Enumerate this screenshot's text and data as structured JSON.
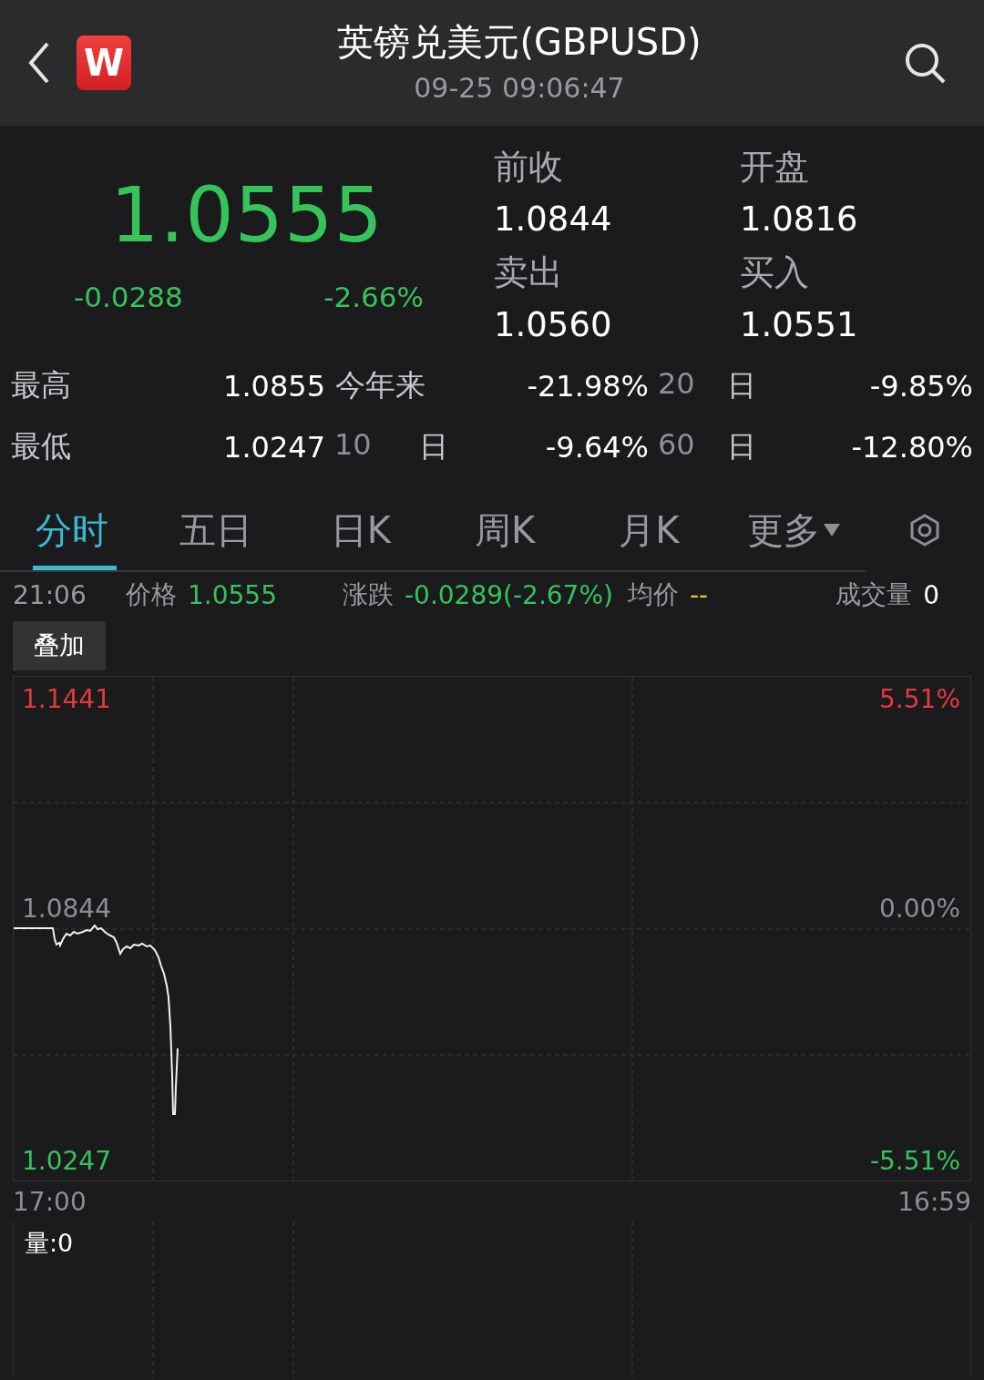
{
  "header": {
    "title": "英镑兑美元(GBPUSD)",
    "timestamp": "09-25 09:06:47",
    "logo_text": "W"
  },
  "quote": {
    "price": "1.0555",
    "change": "-0.0288",
    "change_percent": "-2.66%",
    "color": "#35c35a",
    "fields": [
      {
        "label": "前收",
        "value": "1.0844"
      },
      {
        "label": "开盘",
        "value": "1.0816"
      },
      {
        "label": "卖出",
        "value": "1.0560"
      },
      {
        "label": "买入",
        "value": "1.0551"
      }
    ]
  },
  "stats": [
    [
      {
        "kind": "label",
        "text": "最高"
      },
      {
        "kind": "value",
        "text": "1.0855"
      },
      {
        "kind": "label",
        "text": "今年来"
      },
      {
        "kind": "value",
        "text": "-21.98%"
      },
      {
        "kind": "period",
        "number": "20",
        "unit": "日"
      },
      {
        "kind": "value",
        "text": "-9.85%"
      }
    ],
    [
      {
        "kind": "label",
        "text": "最低"
      },
      {
        "kind": "value",
        "text": "1.0247"
      },
      {
        "kind": "period",
        "number": "10",
        "unit": "日"
      },
      {
        "kind": "value",
        "text": "-9.64%"
      },
      {
        "kind": "period",
        "number": "60",
        "unit": "日"
      },
      {
        "kind": "value",
        "text": "-12.80%"
      }
    ]
  ],
  "tabs": [
    {
      "label": "分时",
      "selected": true
    },
    {
      "label": "五日",
      "selected": false
    },
    {
      "label": "日K",
      "selected": false
    },
    {
      "label": "周K",
      "selected": false
    },
    {
      "label": "月K",
      "selected": false
    },
    {
      "label": "更多",
      "selected": false,
      "kind": "dropdown"
    }
  ],
  "info_bar": {
    "time": "21:06",
    "items": [
      {
        "label": "价格",
        "value": "1.0555",
        "color": "#35c35a"
      },
      {
        "label": "涨跌",
        "value": "-0.0289(-2.67%)",
        "color": "#35c35a"
      },
      {
        "label": "均价",
        "value": "--",
        "color": "#e8c234"
      },
      {
        "label": "成交量",
        "value": "0",
        "color": "#ffffff"
      }
    ]
  },
  "overlay_button": "叠加",
  "chart": {
    "y_left": [
      {
        "text": "1.1441",
        "color": "#e5393e"
      },
      {
        "text": "1.0844",
        "color": "#8e8e93"
      },
      {
        "text": "1.0247",
        "color": "#35c35a"
      }
    ],
    "y_right": [
      {
        "text": "5.51%",
        "color": "#e5393e"
      },
      {
        "text": "0.00%",
        "color": "#8e8e93"
      },
      {
        "text": "-5.51%",
        "color": "#35c35a"
      }
    ],
    "x_start": "17:00",
    "x_end": "16:59",
    "volume_label": "量:0"
  }
}
